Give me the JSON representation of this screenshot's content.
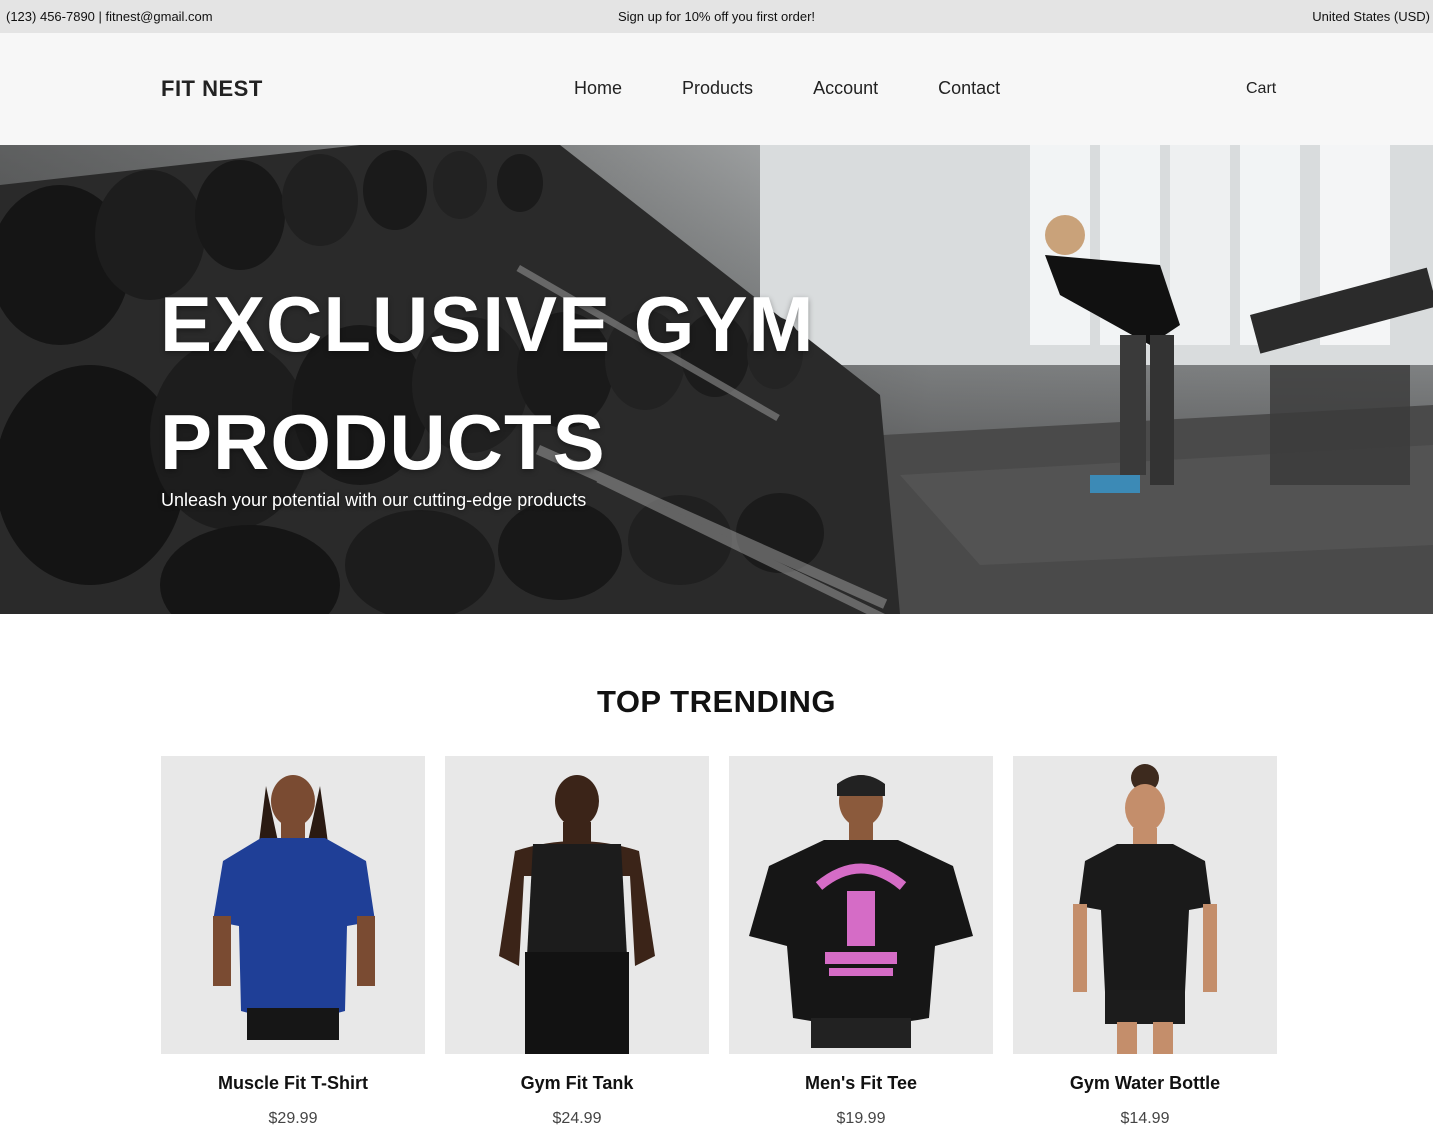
{
  "topbar": {
    "contact": "(123) 456-7890 | fitnest@gmail.com",
    "promo": "Sign up for 10% off you first order!",
    "region": "United States (USD)"
  },
  "header": {
    "logo": "FIT NEST",
    "nav": [
      {
        "label": "Home"
      },
      {
        "label": "Products"
      },
      {
        "label": "Account"
      },
      {
        "label": "Contact"
      }
    ],
    "cart": "Cart"
  },
  "hero": {
    "title_line1": "EXCLUSIVE GYM",
    "title_line2": "PRODUCTS",
    "subtitle": "Unleash your potential with our cutting-edge products"
  },
  "trending": {
    "heading": "TOP TRENDING",
    "products": [
      {
        "name": "Muscle Fit T-Shirt",
        "price": "$29.99",
        "shirt_color": "#1f3f97"
      },
      {
        "name": "Gym Fit Tank",
        "price": "$24.99",
        "shirt_color": "#1c1c1c"
      },
      {
        "name": "Men's Fit Tee",
        "price": "$19.99",
        "shirt_color": "#161616"
      },
      {
        "name": "Gym Water Bottle",
        "price": "$14.99",
        "shirt_color": "#1a1a1a"
      }
    ]
  },
  "colors": {
    "topbar_bg": "#e4e4e4",
    "header_bg": "#f7f7f7",
    "card_bg": "#e8e8e8",
    "graphic_pink": "#d56cc6"
  }
}
